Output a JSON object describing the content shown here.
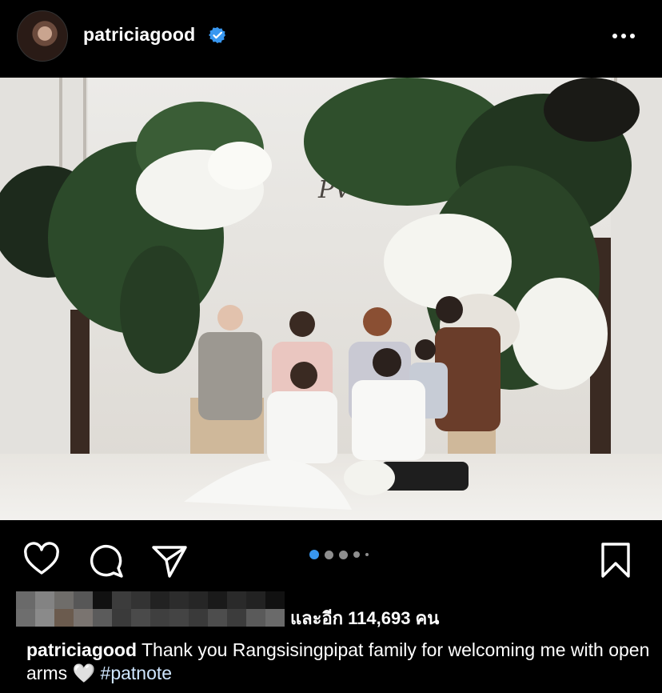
{
  "post": {
    "username": "patriciagood",
    "verified": true,
    "more_icon": "more-horizontal-icon",
    "photo_alt": "",
    "photo_monogram": "PV"
  },
  "actions": {
    "like_icon": "heart-icon",
    "comment_icon": "comment-icon",
    "share_icon": "send-icon",
    "save_icon": "bookmark-icon",
    "carousel_total": 5,
    "carousel_active": 1
  },
  "likes": {
    "text": "และอีก 114,693 คน"
  },
  "caption": {
    "username": "patriciagood",
    "text": "Thank you Rangsisingpipat family for welcoming me with open arms",
    "emoji": "🤍",
    "hashtag": "#patnote"
  },
  "colors": {
    "background": "#000000",
    "verified": "#3897f0",
    "carousel_active": "#3897f0"
  }
}
